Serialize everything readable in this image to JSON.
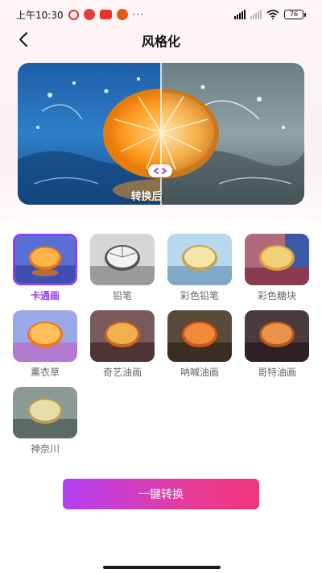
{
  "status_bar": {
    "time": "上午10:30",
    "more": "···",
    "battery": "76"
  },
  "header": {
    "title": "风格化"
  },
  "preview": {
    "caption": "转换后"
  },
  "styles": [
    {
      "label": "卡通画",
      "selected": true
    },
    {
      "label": "铅笔",
      "selected": false
    },
    {
      "label": "彩色铅笔",
      "selected": false
    },
    {
      "label": "彩色糖块",
      "selected": false
    },
    {
      "label": "薰衣草",
      "selected": false
    },
    {
      "label": "奇艺油画",
      "selected": false
    },
    {
      "label": "呐喊油画",
      "selected": false
    },
    {
      "label": "哥特油画",
      "selected": false
    },
    {
      "label": "神奈川",
      "selected": false
    }
  ],
  "actions": {
    "convert_label": "一键转换"
  },
  "colors": {
    "accent": "#8e3ff0",
    "button_gradient_start": "#b33ff3",
    "button_gradient_end": "#f0367a"
  }
}
